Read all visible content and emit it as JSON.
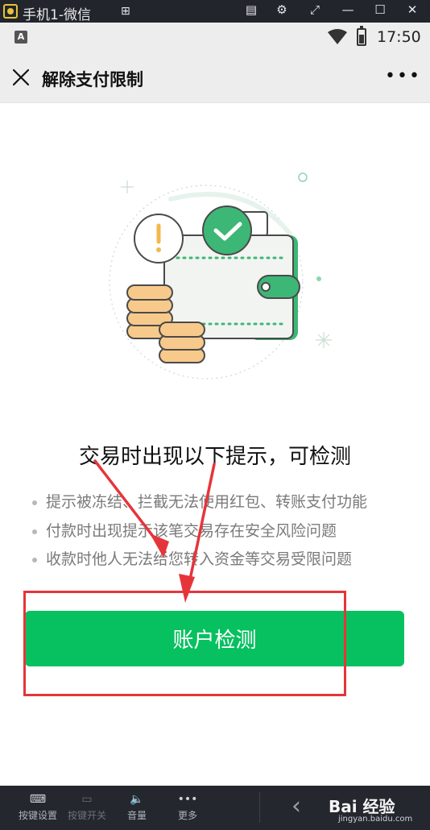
{
  "emulator": {
    "window_title": "手机1-微信",
    "controls": [
      "▤",
      "⚙",
      "⤢",
      "—",
      "☐",
      "✕"
    ],
    "toolbar": [
      {
        "icon": "keyboard-icon",
        "label": "按键设置",
        "enabled": true
      },
      {
        "icon": "keys-toggle-icon",
        "label": "按键开关",
        "enabled": false
      },
      {
        "icon": "volume-icon",
        "label": "音量",
        "enabled": true
      },
      {
        "icon": "more-dots-icon",
        "label": "更多",
        "enabled": true
      }
    ],
    "watermark": "Bai 经验",
    "watermark_sub": "jingyan.baidu.com"
  },
  "status_bar": {
    "notification": "A",
    "time": "17:50"
  },
  "nav": {
    "title": "解除支付限制",
    "more": "•••"
  },
  "content": {
    "heading": "交易时出现以下提示，可检测",
    "tips": [
      "提示被冻结、拦截无法使用红包、转账支付功能",
      "付款时出现提示该笔交易存在安全风险问题",
      "收款时他人无法给您转入资金等交易受限问题"
    ],
    "button_label": "账户检测"
  },
  "colors": {
    "accent": "#07c160",
    "annotation": "#e5353b",
    "coin": "#f7c98b"
  }
}
